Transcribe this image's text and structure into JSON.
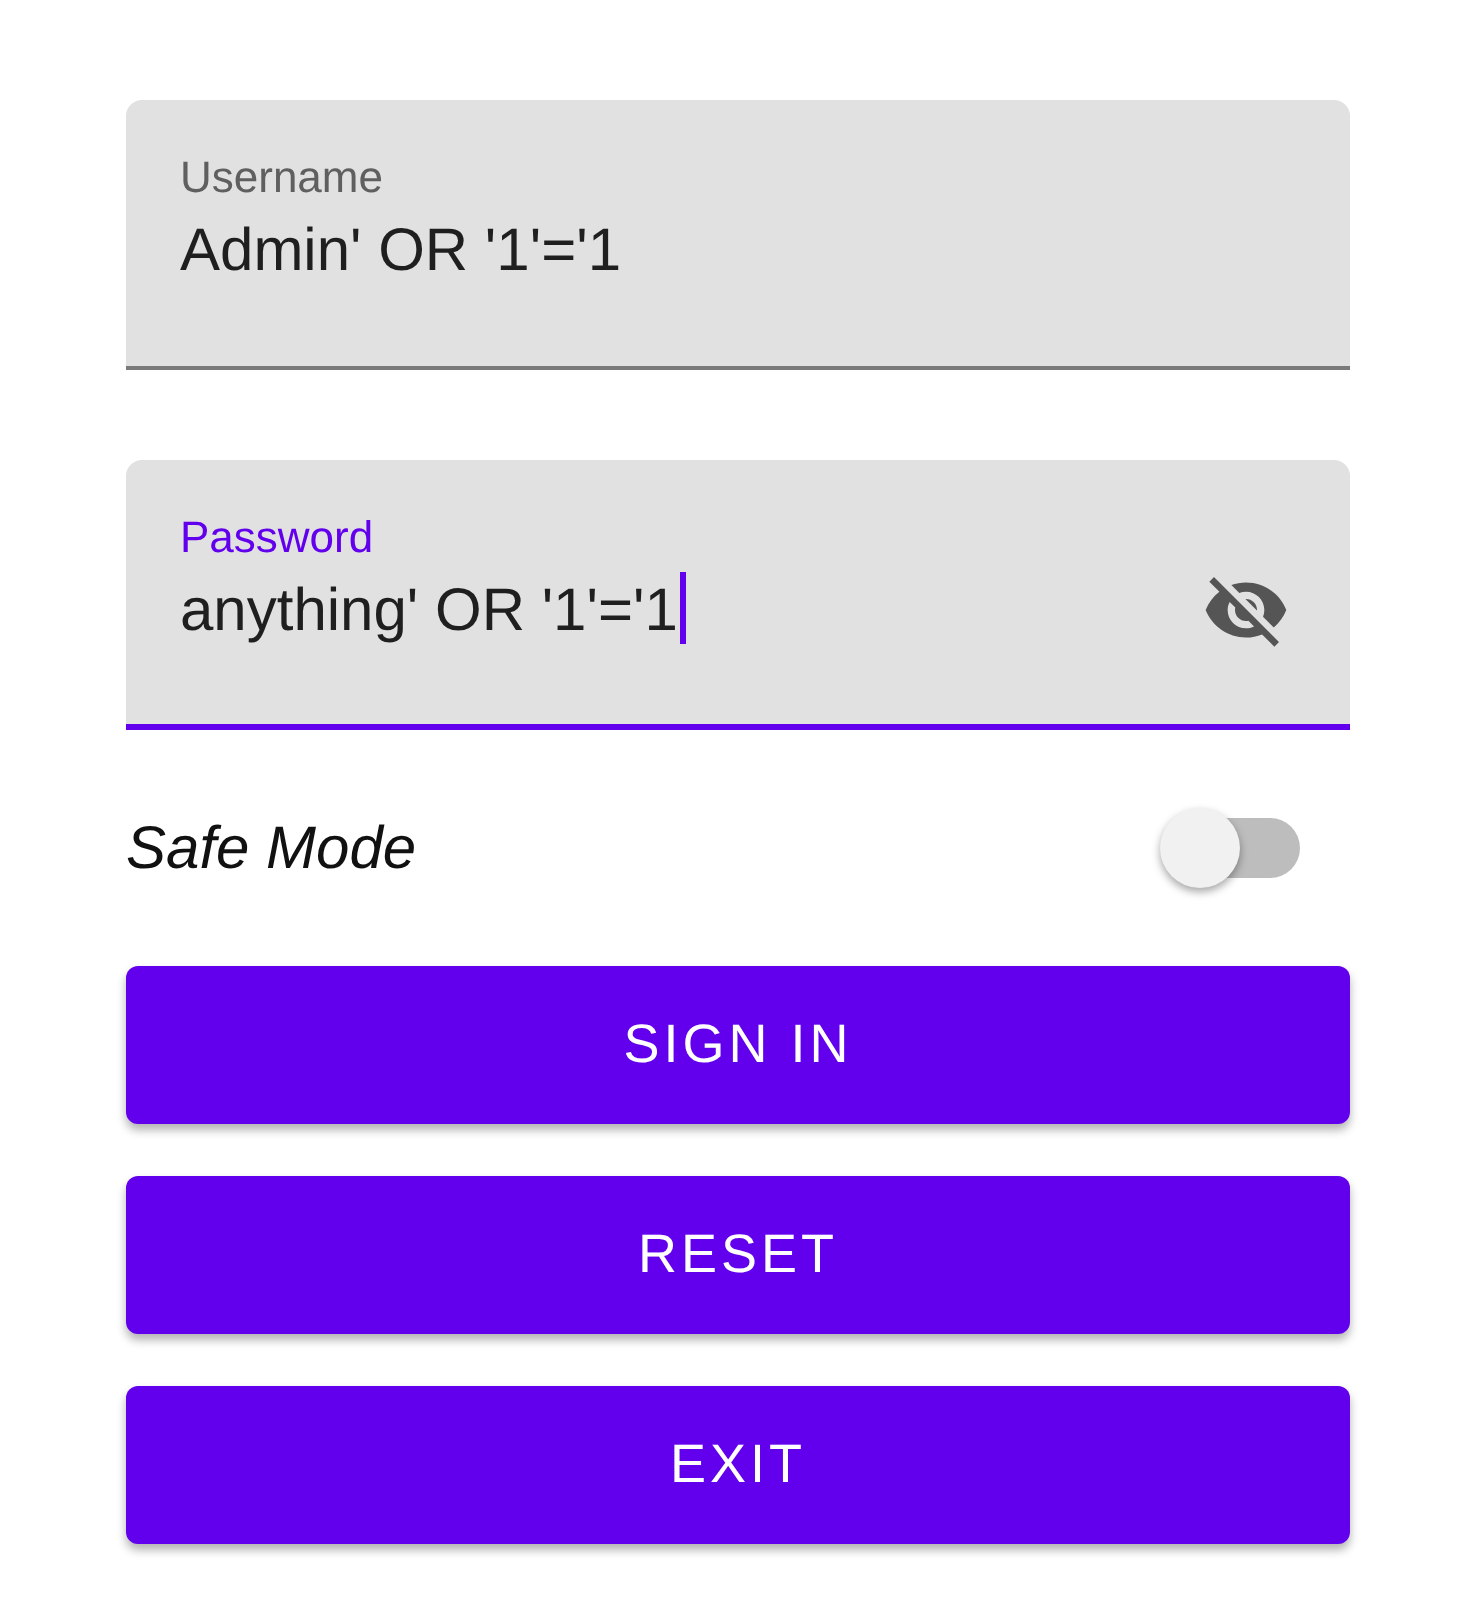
{
  "fields": [
    {
      "kind": "text",
      "label": "Username",
      "value": "Admin' OR '1'='1",
      "focused": false
    },
    {
      "kind": "password",
      "label": "Password",
      "value": "anything' OR '1'='1",
      "focused": true
    }
  ],
  "safe_mode": {
    "label": "Safe Mode",
    "on": false
  },
  "buttons": [
    "SIGN IN",
    "RESET",
    "EXIT"
  ]
}
